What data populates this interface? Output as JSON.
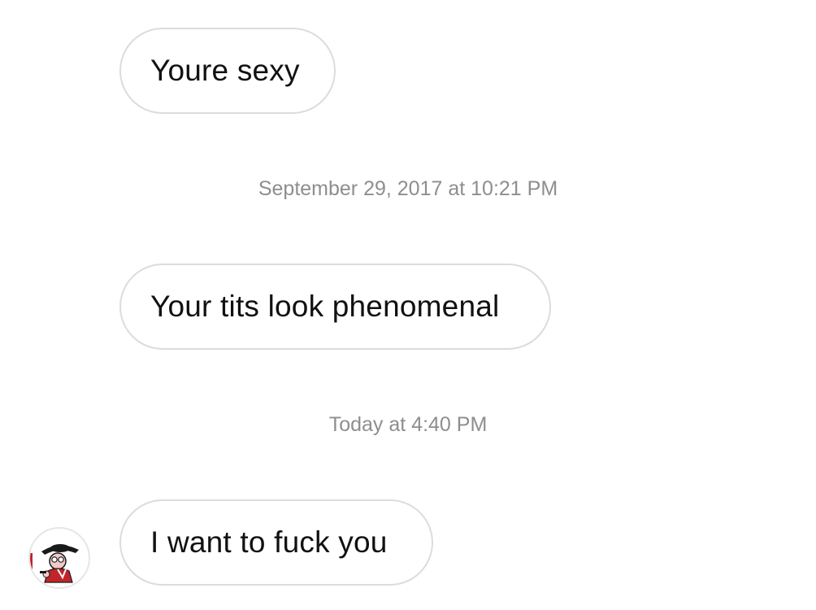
{
  "conversation": {
    "messages": [
      {
        "text": "Youre sexy"
      },
      {
        "text": "Your tits look phenomenal"
      },
      {
        "text": "I want to fuck you"
      }
    ],
    "timestamps": [
      {
        "text": "September 29, 2017 at 10:21 PM"
      },
      {
        "text": "Today at 4:40 PM"
      }
    ],
    "avatar": {
      "icon": "cartoon-character-avatar"
    }
  },
  "colors": {
    "background": "#ffffff",
    "bubble_border": "#dcdcdc",
    "message_text": "#111111",
    "timestamp_text": "#8e8e8e",
    "avatar_accent": "#c0252b"
  }
}
